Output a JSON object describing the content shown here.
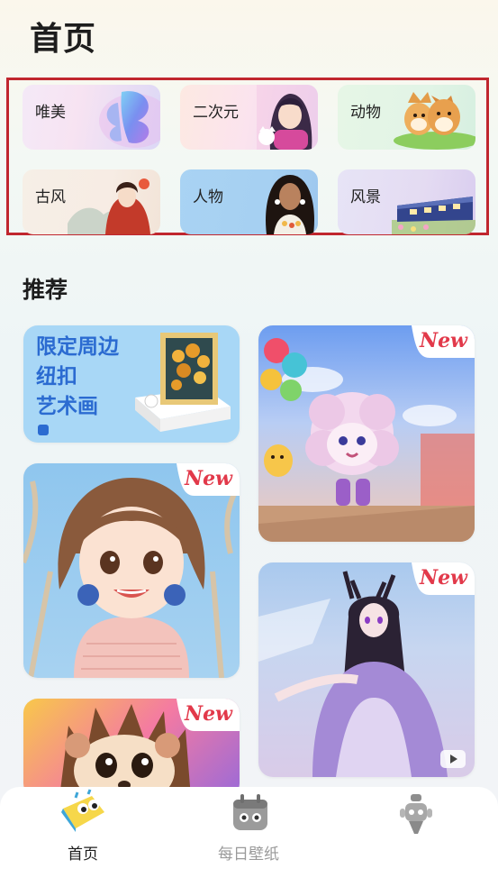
{
  "header": {
    "title": "首页"
  },
  "categories": [
    {
      "label": "唯美"
    },
    {
      "label": "二次元"
    },
    {
      "label": "动物"
    },
    {
      "label": "古风"
    },
    {
      "label": "人物"
    },
    {
      "label": "风景"
    }
  ],
  "recommend": {
    "title": "推荐",
    "banner_text": [
      "限定周边",
      "纽扣",
      "艺术画"
    ],
    "new_badge": "New"
  },
  "tabbar": {
    "items": [
      {
        "label": "首页",
        "active": true
      },
      {
        "label": "每日壁纸",
        "active": false
      },
      {
        "label": "",
        "active": false
      }
    ]
  },
  "colors": {
    "highlight": "#c0262e",
    "new_badge": "#e2394a",
    "banner_text": "#2b6bd1",
    "inactive_tab": "#9a9a9a"
  }
}
